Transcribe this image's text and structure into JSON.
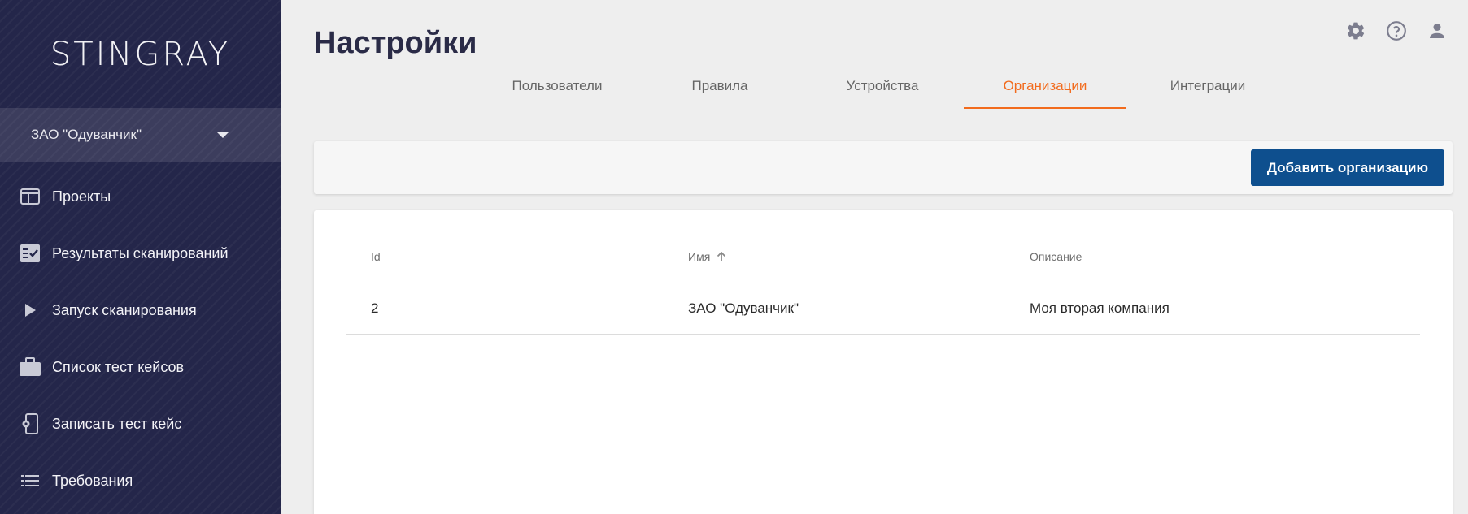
{
  "sidebar": {
    "logo": "STINGRAY",
    "org_select": {
      "value": "ЗАО \"Одуванчик\""
    },
    "items": [
      {
        "label": "Проекты",
        "icon": "projects-icon"
      },
      {
        "label": "Результаты сканирований",
        "icon": "scan-results-icon"
      },
      {
        "label": "Запуск сканирования",
        "icon": "play-icon"
      },
      {
        "label": "Список тест кейсов",
        "icon": "briefcase-icon"
      },
      {
        "label": "Записать тест кейс",
        "icon": "phone-record-icon"
      },
      {
        "label": "Требования",
        "icon": "list-icon"
      }
    ]
  },
  "header": {
    "title": "Настройки",
    "icons": [
      "gear-icon",
      "help-icon",
      "user-icon"
    ]
  },
  "tabs": [
    {
      "label": "Пользователи",
      "active": false
    },
    {
      "label": "Правила",
      "active": false
    },
    {
      "label": "Устройства",
      "active": false
    },
    {
      "label": "Организации",
      "active": true
    },
    {
      "label": "Интеграции",
      "active": false
    }
  ],
  "toolbar": {
    "add_label": "Добавить организацию"
  },
  "table": {
    "columns": [
      "Id",
      "Имя",
      "Описание"
    ],
    "sort": {
      "column": "Имя",
      "direction": "asc"
    },
    "rows": [
      {
        "id": "2",
        "name": "ЗАО \"Одуванчик\"",
        "description": "Моя вторая компания"
      }
    ]
  },
  "colors": {
    "sidebar_bg": "#24264a",
    "accent": "#f26b1d",
    "primary_button": "#0e4f8e"
  }
}
